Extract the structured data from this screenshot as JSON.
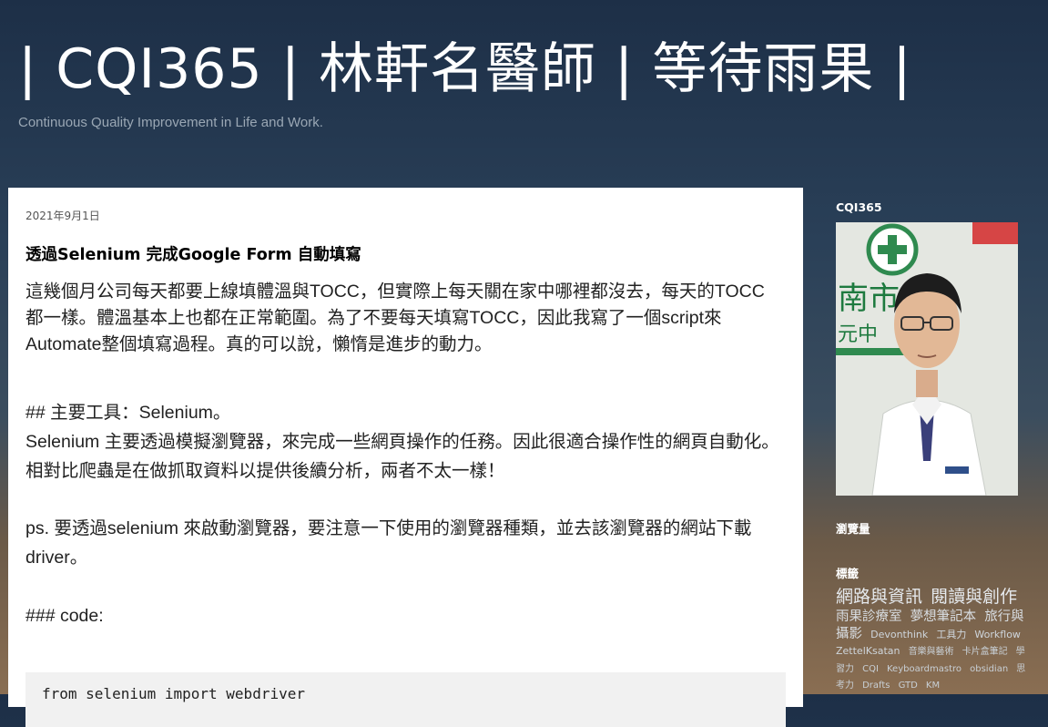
{
  "header": {
    "title": "| CQI365 | 林軒名醫師 | 等待雨果 |",
    "description": "Continuous Quality Improvement in Life and Work."
  },
  "post": {
    "date": "2021年9月1日",
    "title": "透過Selenium 完成Google Form 自動填寫",
    "paragraph_1": "這幾個月公司每天都要上線填體溫與TOCC，但實際上每天關在家中哪裡都沒去，每天的TOCC都一樣。體溫基本上也都在正常範圍。為了不要每天填寫TOCC，因此我寫了一個script來Automate整個填寫過程。真的可以說，懶惰是進步的動力。",
    "heading_tools": "## 主要工具：Selenium。",
    "paragraph_2": "Selenium 主要透過模擬瀏覽器，來完成一些網頁操作的任務。因此很適合操作性的網頁自動化。相對比爬蟲是在做抓取資料以提供後續分析，兩者不太一樣！",
    "paragraph_3": "ps. 要透過selenium 來啟動瀏覽器，要注意一下使用的瀏覽器種類，並去該瀏覽器的網站下載driver。",
    "heading_code": "### code:",
    "code_line": "from selenium import webdriver"
  },
  "sidebar": {
    "profile_title": "CQI365",
    "views_title": "瀏覽量",
    "labels_title": "標籤",
    "labels": [
      {
        "text": "網路與資訊",
        "size": "l1"
      },
      {
        "text": "閱讀與創作",
        "size": "l1"
      },
      {
        "text": "雨果診療室",
        "size": "l2"
      },
      {
        "text": "夢想筆記本",
        "size": "l2"
      },
      {
        "text": "旅行與攝影",
        "size": "l2"
      },
      {
        "text": "Devonthink",
        "size": "l3"
      },
      {
        "text": "工具力",
        "size": "l3"
      },
      {
        "text": "Workflow",
        "size": "l3"
      },
      {
        "text": "ZettelKsatan",
        "size": "l3"
      },
      {
        "text": "音樂與藝術",
        "size": "l4"
      },
      {
        "text": "卡片盒筆記",
        "size": "l4"
      },
      {
        "text": "學習力",
        "size": "l4"
      },
      {
        "text": "CQI",
        "size": "l4"
      },
      {
        "text": "Keyboardmastro",
        "size": "l4"
      },
      {
        "text": "obsidian",
        "size": "l4"
      },
      {
        "text": "思考力",
        "size": "l4"
      },
      {
        "text": "Drafts",
        "size": "l4"
      },
      {
        "text": "GTD",
        "size": "l4"
      },
      {
        "text": "KM",
        "size": "l4"
      }
    ]
  }
}
